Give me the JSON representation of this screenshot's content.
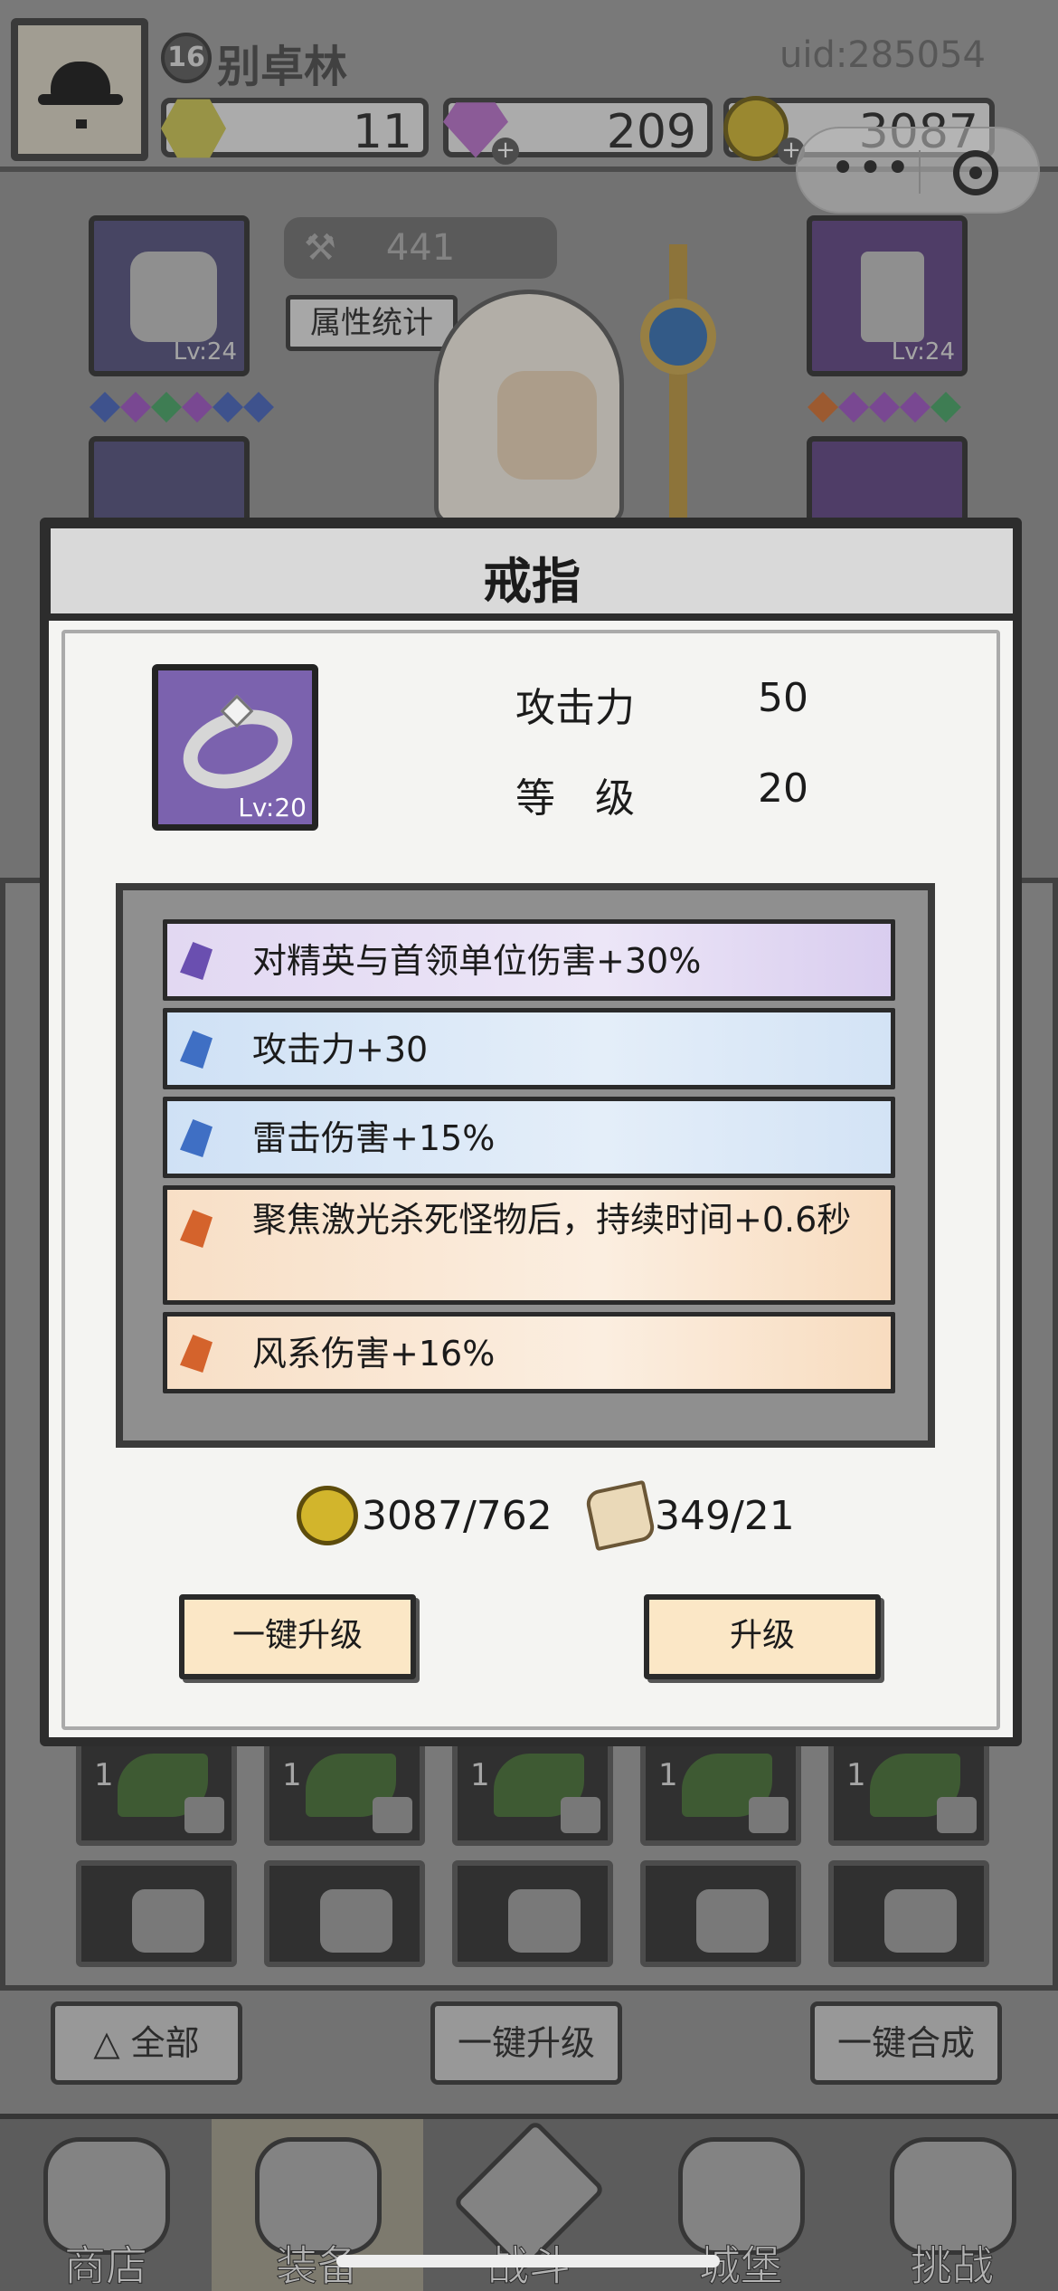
{
  "header": {
    "level": "16",
    "player_name": "别卓林",
    "uid": "uid:285054",
    "resources": [
      {
        "name": "gem",
        "value": "11"
      },
      {
        "name": "diamond",
        "value": "209"
      },
      {
        "name": "coin",
        "value": "3087"
      }
    ]
  },
  "equipment": {
    "power": "441",
    "stats_button": "属性统计",
    "left_slot_level": "Lv:24",
    "right_slot_level": "Lv:24"
  },
  "modal": {
    "title": "戒指",
    "item_level": "Lv:20",
    "stats": [
      {
        "label": "攻击力",
        "value": "50"
      },
      {
        "label": "等　级",
        "value": "20"
      }
    ],
    "affixes": [
      {
        "text": "对精英与首领单位伤害+30%",
        "color": "purple"
      },
      {
        "text": "攻击力+30",
        "color": "blue"
      },
      {
        "text": "雷击伤害+15%",
        "color": "blue"
      },
      {
        "text": "聚焦激光杀死怪物后，持续时间+0.6秒",
        "color": "orange"
      },
      {
        "text": "风系伤害+16%",
        "color": "orange"
      }
    ],
    "costs": {
      "coin": "3087/762",
      "scroll": "349/21"
    },
    "buttons": {
      "one_click_upgrade": "一键升级",
      "upgrade": "升级"
    }
  },
  "bag": {
    "counts": [
      "1",
      "1",
      "1",
      "1",
      "1"
    ]
  },
  "bottom_buttons": {
    "all": "全部",
    "one_click_upgrade": "一键升级",
    "one_click_merge": "一键合成"
  },
  "tabs": [
    {
      "label": "商店"
    },
    {
      "label": "装备"
    },
    {
      "label": "战斗"
    },
    {
      "label": "城堡"
    },
    {
      "label": "挑战"
    }
  ],
  "colors": {
    "affix_purple": "#e2d8f2",
    "affix_blue": "#cfe1f5",
    "affix_orange": "#f8dfc6",
    "button_bg": "#fbe7c6"
  }
}
